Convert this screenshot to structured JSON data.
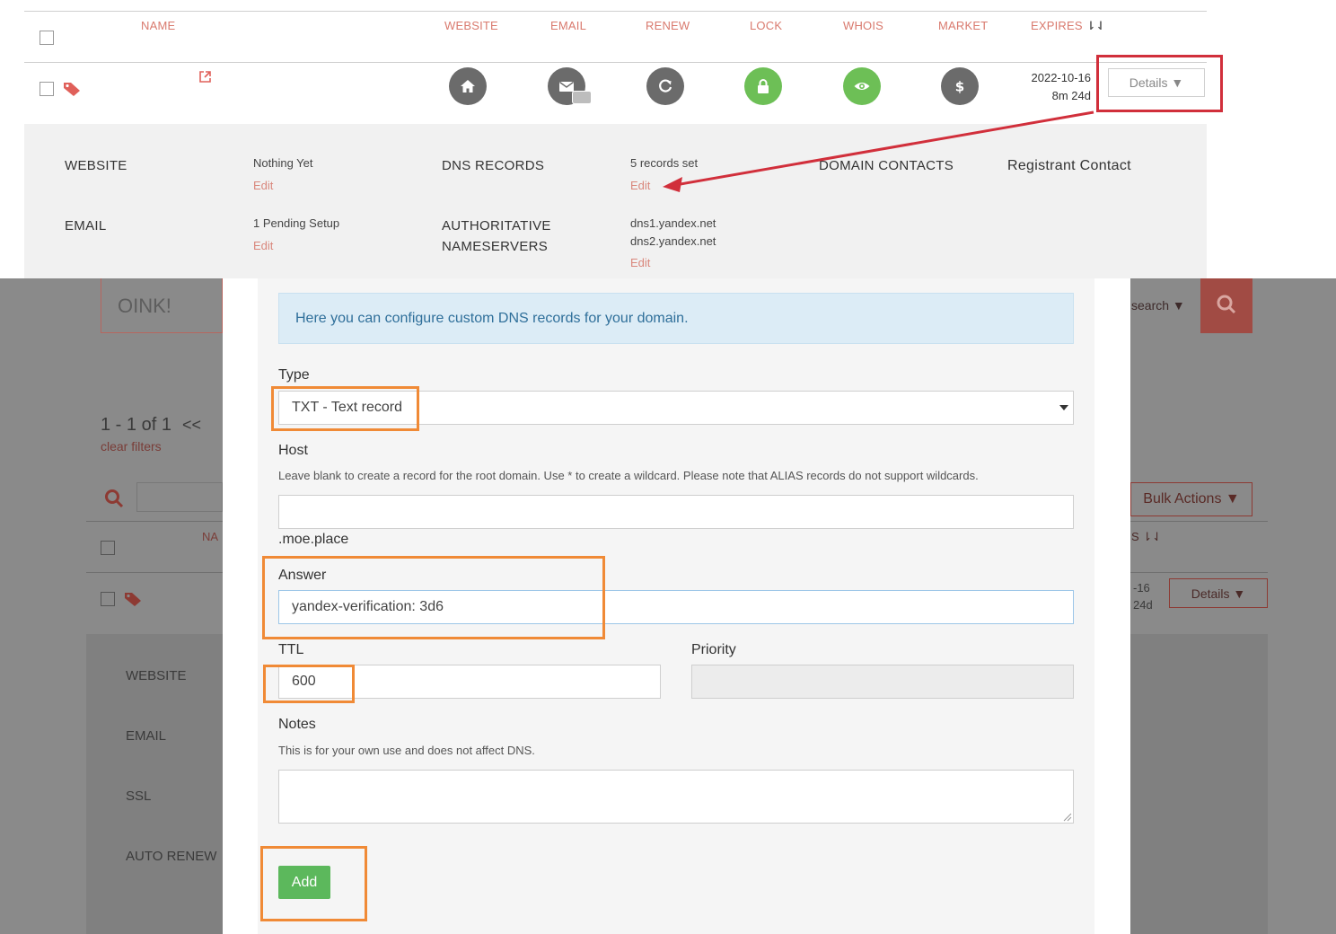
{
  "table": {
    "headers": [
      "NAME",
      "WEBSITE",
      "EMAIL",
      "RENEW",
      "LOCK",
      "WHOIS",
      "MARKET",
      "EXPIRES"
    ],
    "row": {
      "expires_date": "2022-10-16",
      "expires_remaining": "8m 24d",
      "details_label": "Details ▼",
      "icons": [
        "home-icon",
        "envelope-icon",
        "refresh-icon",
        "lock-icon",
        "eye-icon",
        "dollar-icon"
      ]
    }
  },
  "details": {
    "website_label": "WEBSITE",
    "website_value": "Nothing Yet",
    "website_edit": "Edit",
    "email_label": "EMAIL",
    "email_value": "1 Pending Setup",
    "email_edit": "Edit",
    "dns_label": "DNS RECORDS",
    "dns_value": "5 records set",
    "dns_edit": "Edit",
    "ns_label_1": "AUTHORITATIVE",
    "ns_label_2": "NAMESERVERS",
    "ns_value_1": "dns1.yandex.net",
    "ns_value_2": "dns2.yandex.net",
    "ns_edit": "Edit",
    "contacts_label": "DOMAIN CONTACTS",
    "registrant_label": "Registrant Contact"
  },
  "background": {
    "search_text": "OINK!",
    "search_dropdown": "search",
    "pagination": "1 - 1 of 1",
    "pagination_prev": "<<",
    "clear_filters": "clear filters",
    "bulk_actions": "Bulk Actions ▼",
    "name_header": "NA",
    "details_label": "Details ▼",
    "date_partial": "-16",
    "remaining_partial": "24d",
    "side_labels": [
      "WEBSITE",
      "EMAIL",
      "SSL",
      "AUTO RENEW"
    ]
  },
  "modal": {
    "info": "Here you can configure custom DNS records for your domain.",
    "type_label": "Type",
    "type_value": "TXT - Text record",
    "host_label": "Host",
    "host_help": "Leave blank to create a record for the root domain. Use * to create a wildcard. Please note that ALIAS records do not support wildcards.",
    "host_value": "",
    "host_suffix": ".moe.place",
    "answer_label": "Answer",
    "answer_value": "yandex-verification: 3d6",
    "ttl_label": "TTL",
    "ttl_value": "600",
    "priority_label": "Priority",
    "notes_label": "Notes",
    "notes_help": "This is for your own use and does not affect DNS.",
    "notes_value": "",
    "add_label": "Add"
  },
  "colors": {
    "accent_salmon": "#d97a6e",
    "green": "#5cb85c",
    "annotation_red": "#d12f3b",
    "annotation_orange": "#f08a36"
  }
}
